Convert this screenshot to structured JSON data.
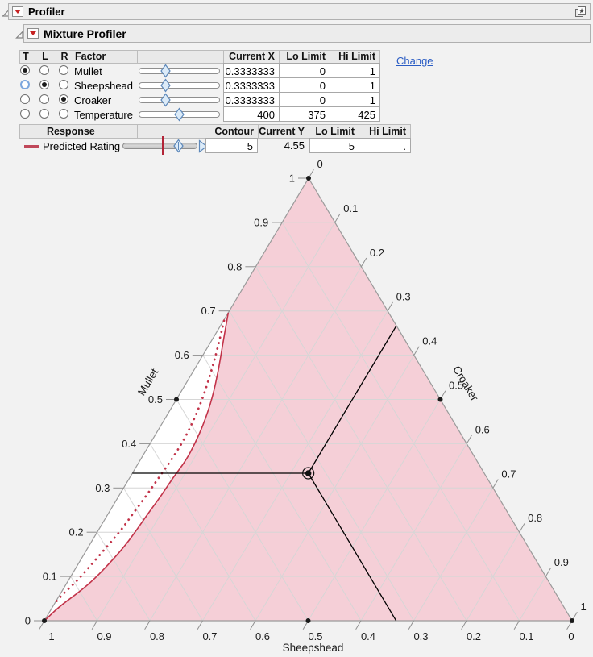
{
  "outline": {
    "title": "Profiler",
    "subtitle": "Mixture Profiler"
  },
  "factor_table": {
    "headers": {
      "t": "T",
      "l": "L",
      "r": "R",
      "factor": "Factor",
      "current_x": "Current X",
      "lo_limit": "Lo Limit",
      "hi_limit": "Hi Limit"
    },
    "change_link": "Change",
    "rows": [
      {
        "name": "Mullet",
        "radios": {
          "t": "on",
          "l": "off",
          "r": "off"
        },
        "slider_frac": 0.333,
        "current_x": "0.3333333",
        "lo": "0",
        "hi": "1"
      },
      {
        "name": "Sheepshead",
        "radios": {
          "t": "focus",
          "l": "on",
          "r": "off"
        },
        "slider_frac": 0.333,
        "current_x": "0.3333333",
        "lo": "0",
        "hi": "1"
      },
      {
        "name": "Croaker",
        "radios": {
          "t": "off",
          "l": "off",
          "r": "on"
        },
        "slider_frac": 0.333,
        "current_x": "0.3333333",
        "lo": "0",
        "hi": "1"
      },
      {
        "name": "Temperature",
        "radios": {
          "t": "off",
          "l": "off",
          "r": "off"
        },
        "slider_frac": 0.5,
        "current_x": "400",
        "lo": "375",
        "hi": "425"
      }
    ]
  },
  "response_table": {
    "headers": {
      "response": "Response",
      "contour": "Contour",
      "current_y": "Current Y",
      "lo_limit": "Lo Limit",
      "hi_limit": "Hi Limit"
    },
    "row": {
      "name": "Predicted Rating",
      "swatch_color": "#c0485a",
      "marker_frac": 0.54,
      "thumb_frac": 0.75,
      "contour": "5",
      "current_y": "4.55",
      "lo": "5",
      "hi": "."
    }
  },
  "chart_data": {
    "type": "ternary-contour-profiler",
    "axes": {
      "mullet": {
        "title": "Mullet",
        "ticks": [
          "1",
          "0.9",
          "0.8",
          "0.7",
          "0.6",
          "0.5",
          "0.4",
          "0.3",
          "0.2",
          "0.1",
          "0"
        ]
      },
      "croaker": {
        "title": "Croaker",
        "ticks": [
          "0",
          "0.1",
          "0.2",
          "0.3",
          "0.4",
          "0.5",
          "0.6",
          "0.7",
          "0.8",
          "0.9",
          "1"
        ]
      },
      "sheepshead": {
        "title": "Sheepshead",
        "ticks": [
          "1",
          "0.9",
          "0.8",
          "0.7",
          "0.6",
          "0.5",
          "0.4",
          "0.3",
          "0.2",
          "0.1",
          "0"
        ]
      }
    },
    "current_point": {
      "mullet": 0.3333333,
      "sheepshead": 0.3333333,
      "croaker": 0.3333333
    },
    "contour": {
      "response": "Predicted Rating",
      "level": 5,
      "solid_mc": [
        [
          0.696,
          0.0
        ],
        [
          0.628,
          0.024
        ],
        [
          0.565,
          0.047
        ],
        [
          0.501,
          0.067
        ],
        [
          0.446,
          0.079
        ],
        [
          0.401,
          0.085
        ],
        [
          0.361,
          0.087
        ],
        [
          0.324,
          0.082
        ],
        [
          0.282,
          0.08
        ],
        [
          0.24,
          0.075
        ],
        [
          0.2,
          0.072
        ],
        [
          0.164,
          0.067
        ],
        [
          0.124,
          0.057
        ],
        [
          0.087,
          0.045
        ],
        [
          0.058,
          0.029
        ],
        [
          0.031,
          0.012
        ],
        [
          0.002,
          0.001
        ]
      ],
      "dotted_mc": [
        [
          0.678,
          0.001
        ],
        [
          0.623,
          0.018
        ],
        [
          0.568,
          0.033
        ],
        [
          0.51,
          0.047
        ],
        [
          0.455,
          0.056
        ],
        [
          0.408,
          0.06
        ],
        [
          0.364,
          0.059
        ],
        [
          0.324,
          0.055
        ],
        [
          0.284,
          0.052
        ],
        [
          0.244,
          0.047
        ],
        [
          0.204,
          0.043
        ],
        [
          0.168,
          0.035
        ],
        [
          0.128,
          0.026
        ],
        [
          0.091,
          0.017
        ],
        [
          0.06,
          0.005
        ],
        [
          0.04,
          0.0
        ]
      ]
    },
    "colors": {
      "region_fill": "#f5cfd7",
      "unshaded_fill": "#ffffff",
      "grid": "#d6d6d6",
      "frame": "#9a9a9a",
      "contour": "#c23349",
      "crosshair": "#000000"
    }
  }
}
